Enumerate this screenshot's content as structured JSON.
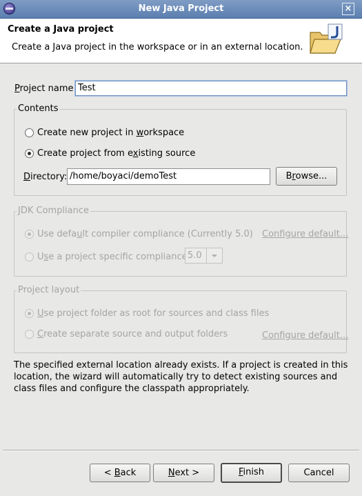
{
  "window": {
    "title": "New Java Project",
    "close_glyph": "×"
  },
  "banner": {
    "title": "Create a Java project",
    "description": "Create a Java project in the workspace or in an external location."
  },
  "project_name": {
    "label_u": "P",
    "label_rest": "roject name:",
    "value": "Test"
  },
  "contents": {
    "title": "Contents",
    "option_new_a": "Create new project in ",
    "option_new_u": "w",
    "option_new_b": "orkspace",
    "option_existing_a": "Create project from e",
    "option_existing_u": "x",
    "option_existing_b": "isting source",
    "directory_label_u": "D",
    "directory_label_rest": "irectory:",
    "directory_value": "/home/boyaci/demoTest",
    "browse_a": "B",
    "browse_u": "r",
    "browse_b": "owse..."
  },
  "jdk": {
    "title": "JDK Compliance",
    "default_a": "Use defa",
    "default_u": "u",
    "default_b": "lt compiler compliance (Currently 5.0)",
    "configure_link": "Configure default...",
    "specific_a": "U",
    "specific_u": "s",
    "specific_b": "e a project specific compliance:",
    "compliance_value": "5.0"
  },
  "layout": {
    "title": "Project layout",
    "root_a": "",
    "root_u": "U",
    "root_b": "se project folder as root for sources and class files",
    "separate_a": "",
    "separate_u": "C",
    "separate_b": "reate separate source and output folders",
    "configure_link": "Configure default..."
  },
  "info_message": "The specified external location already exists. If a project is created in this location, the wizard will automatically try to detect existing sources and class files and configure the classpath appropriately.",
  "buttons": {
    "back_a": "< ",
    "back_u": "B",
    "back_b": "ack",
    "next_a": "",
    "next_u": "N",
    "next_b": "ext >",
    "finish_a": "",
    "finish_u": "F",
    "finish_b": "inish",
    "cancel": "Cancel"
  },
  "icons": {
    "app": "eclipse-icon",
    "wizard": "java-folder-icon"
  },
  "colors": {
    "titlebar": "#6a8bbb",
    "window_bg": "#e8e8e6",
    "focus": "#6f8fbf"
  }
}
